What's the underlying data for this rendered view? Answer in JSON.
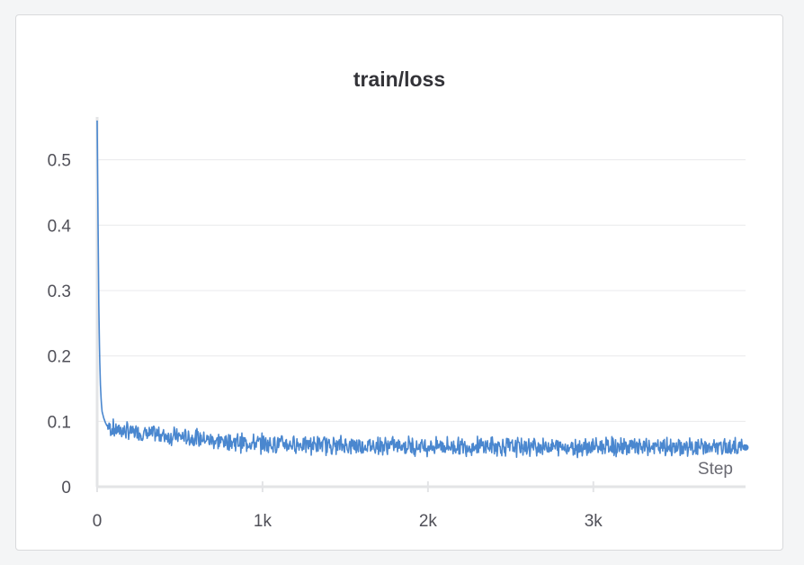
{
  "chart_data": {
    "type": "line",
    "title": "train/loss",
    "xlabel": "Step",
    "ylabel": "",
    "xlim": [
      0,
      3920
    ],
    "ylim": [
      0,
      0.56
    ],
    "xticks": [
      0,
      1000,
      2000,
      3000
    ],
    "xtick_labels": [
      "0",
      "1k",
      "2k",
      "3k"
    ],
    "yticks": [
      0,
      0.1,
      0.2,
      0.3,
      0.4,
      0.5
    ],
    "ytick_labels": [
      "0",
      "0.1",
      "0.2",
      "0.3",
      "0.4",
      "0.5"
    ],
    "grid": true,
    "series": [
      {
        "color": "#4a87cf",
        "x": [
          0,
          5,
          10,
          15,
          20,
          25,
          30,
          40,
          50,
          60,
          80,
          100,
          150,
          200,
          300,
          400,
          500,
          600,
          700,
          800,
          900,
          1000,
          1200,
          1400,
          1600,
          1800,
          2000,
          2200,
          2400,
          2600,
          2800,
          3000,
          3200,
          3400,
          3600,
          3800,
          3920
        ],
        "y": [
          0.56,
          0.42,
          0.28,
          0.2,
          0.155,
          0.13,
          0.115,
          0.105,
          0.098,
          0.093,
          0.09,
          0.088,
          0.086,
          0.084,
          0.081,
          0.079,
          0.076,
          0.074,
          0.071,
          0.069,
          0.067,
          0.066,
          0.065,
          0.064,
          0.063,
          0.063,
          0.062,
          0.062,
          0.062,
          0.061,
          0.061,
          0.061,
          0.061,
          0.06,
          0.06,
          0.06,
          0.06
        ],
        "noise_amplitude": 0.012
      }
    ]
  }
}
